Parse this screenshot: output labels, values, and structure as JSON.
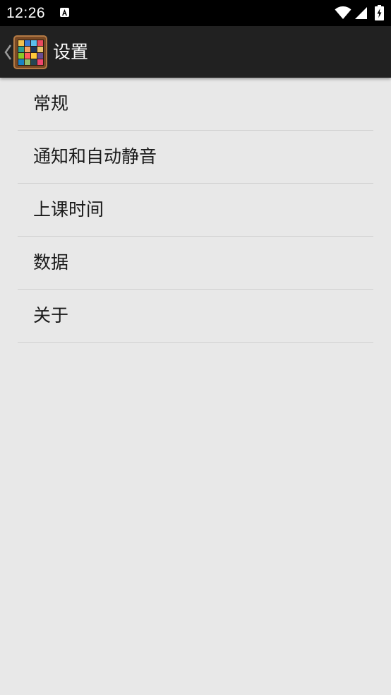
{
  "status_bar": {
    "time": "12:26",
    "icons": [
      "a-notification-icon",
      "wifi-icon",
      "signal-icon",
      "battery-charging-icon"
    ]
  },
  "action_bar": {
    "title": "设置",
    "back_icon": "chevron-left-icon",
    "app_icon": "app-grid-icon",
    "app_icon_colors": [
      "#f2c14e",
      "#3a7bd5",
      "#5bc0eb",
      "#e84a5f",
      "#2a9d8f",
      "#f4a261",
      "#1d3557",
      "#e9c46a",
      "#8ac926",
      "#ff595e",
      "#ffca3a",
      "#6a4c93",
      "#1982c4",
      "#90be6d",
      "#264653",
      "#ef476f"
    ]
  },
  "settings": {
    "items": [
      {
        "label": "常规"
      },
      {
        "label": "通知和自动静音"
      },
      {
        "label": "上课时间"
      },
      {
        "label": "数据"
      },
      {
        "label": "关于"
      }
    ]
  },
  "colors": {
    "status_bar_bg": "#000000",
    "action_bar_bg": "#212121",
    "page_bg": "#e8e8e8",
    "divider": "#cfcfcf"
  }
}
